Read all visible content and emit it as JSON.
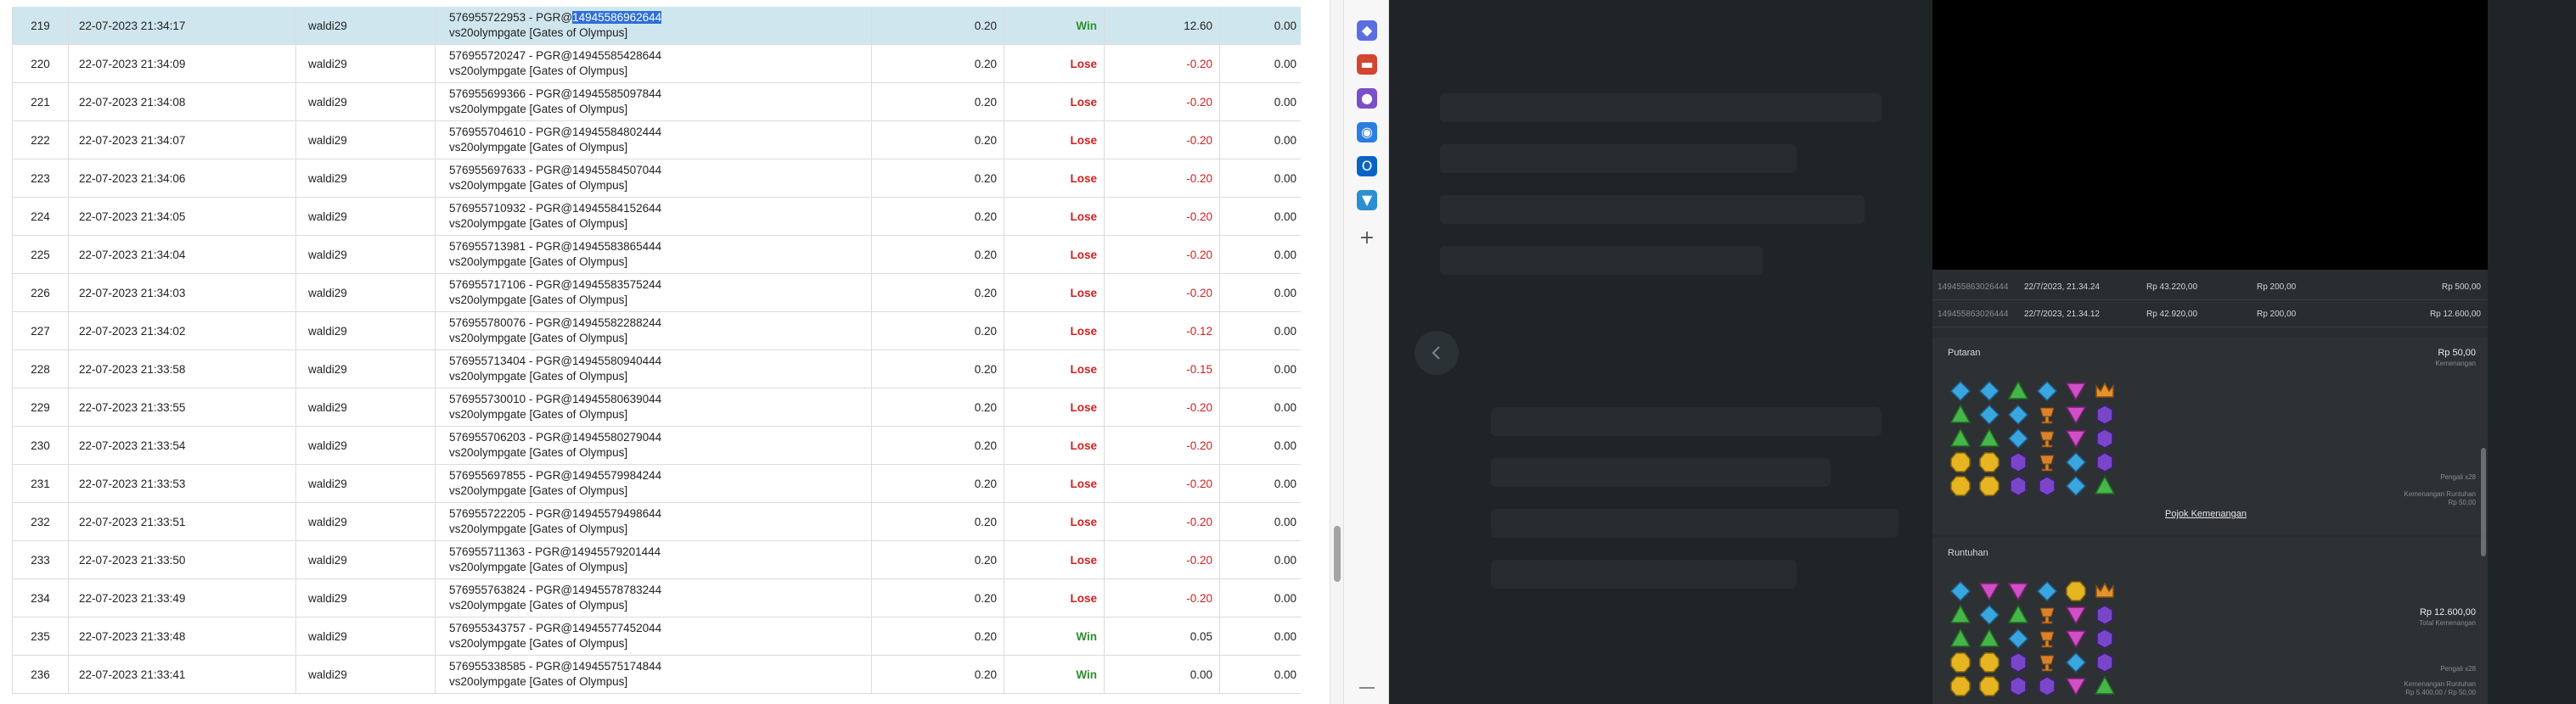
{
  "colors": {
    "selected_row": "#cfe6ee",
    "win": "#2f8f2f",
    "lose": "#d21f1f",
    "highlight": "#2f6fd6",
    "dark_bg": "#1f2427",
    "panel_bg": "#2a2d30"
  },
  "report": {
    "rows": [
      {
        "no": "219",
        "date": "22-07-2023 21:34:17",
        "user": "waldi29",
        "desc_prefix": "576955722953 - PGR@",
        "desc_hl": "14945586962644",
        "desc_line2": "vs20olympgate [Gates of Olympus]",
        "bet": "0.20",
        "result": "Win",
        "amount": "12.60",
        "balance": "0.00"
      },
      {
        "no": "220",
        "date": "22-07-2023 21:34:09",
        "user": "waldi29",
        "desc_prefix": "576955720247 - PGR@14945585428644",
        "desc_hl": "",
        "desc_line2": "vs20olympgate [Gates of Olympus]",
        "bet": "0.20",
        "result": "Lose",
        "amount": "-0.20",
        "balance": "0.00"
      },
      {
        "no": "221",
        "date": "22-07-2023 21:34:08",
        "user": "waldi29",
        "desc_prefix": "576955699366 - PGR@14945585097844",
        "desc_hl": "",
        "desc_line2": "vs20olympgate [Gates of Olympus]",
        "bet": "0.20",
        "result": "Lose",
        "amount": "-0.20",
        "balance": "0.00"
      },
      {
        "no": "222",
        "date": "22-07-2023 21:34:07",
        "user": "waldi29",
        "desc_prefix": "576955704610 - PGR@14945584802444",
        "desc_hl": "",
        "desc_line2": "vs20olympgate [Gates of Olympus]",
        "bet": "0.20",
        "result": "Lose",
        "amount": "-0.20",
        "balance": "0.00"
      },
      {
        "no": "223",
        "date": "22-07-2023 21:34:06",
        "user": "waldi29",
        "desc_prefix": "576955697633 - PGR@14945584507044",
        "desc_hl": "",
        "desc_line2": "vs20olympgate [Gates of Olympus]",
        "bet": "0.20",
        "result": "Lose",
        "amount": "-0.20",
        "balance": "0.00"
      },
      {
        "no": "224",
        "date": "22-07-2023 21:34:05",
        "user": "waldi29",
        "desc_prefix": "576955710932 - PGR@14945584152644",
        "desc_hl": "",
        "desc_line2": "vs20olympgate [Gates of Olympus]",
        "bet": "0.20",
        "result": "Lose",
        "amount": "-0.20",
        "balance": "0.00"
      },
      {
        "no": "225",
        "date": "22-07-2023 21:34:04",
        "user": "waldi29",
        "desc_prefix": "576955713981 - PGR@14945583865444",
        "desc_hl": "",
        "desc_line2": "vs20olympgate [Gates of Olympus]",
        "bet": "0.20",
        "result": "Lose",
        "amount": "-0.20",
        "balance": "0.00"
      },
      {
        "no": "226",
        "date": "22-07-2023 21:34:03",
        "user": "waldi29",
        "desc_prefix": "576955717106 - PGR@14945583575244",
        "desc_hl": "",
        "desc_line2": "vs20olympgate [Gates of Olympus]",
        "bet": "0.20",
        "result": "Lose",
        "amount": "-0.20",
        "balance": "0.00"
      },
      {
        "no": "227",
        "date": "22-07-2023 21:34:02",
        "user": "waldi29",
        "desc_prefix": "576955780076 - PGR@14945582288244",
        "desc_hl": "",
        "desc_line2": "vs20olympgate [Gates of Olympus]",
        "bet": "0.20",
        "result": "Lose",
        "amount": "-0.12",
        "balance": "0.00"
      },
      {
        "no": "228",
        "date": "22-07-2023 21:33:58",
        "user": "waldi29",
        "desc_prefix": "576955713404 - PGR@14945580940444",
        "desc_hl": "",
        "desc_line2": "vs20olympgate [Gates of Olympus]",
        "bet": "0.20",
        "result": "Lose",
        "amount": "-0.15",
        "balance": "0.00"
      },
      {
        "no": "229",
        "date": "22-07-2023 21:33:55",
        "user": "waldi29",
        "desc_prefix": "576955730010 - PGR@14945580639044",
        "desc_hl": "",
        "desc_line2": "vs20olympgate [Gates of Olympus]",
        "bet": "0.20",
        "result": "Lose",
        "amount": "-0.20",
        "balance": "0.00"
      },
      {
        "no": "230",
        "date": "22-07-2023 21:33:54",
        "user": "waldi29",
        "desc_prefix": "576955706203 - PGR@14945580279044",
        "desc_hl": "",
        "desc_line2": "vs20olympgate [Gates of Olympus]",
        "bet": "0.20",
        "result": "Lose",
        "amount": "-0.20",
        "balance": "0.00"
      },
      {
        "no": "231",
        "date": "22-07-2023 21:33:53",
        "user": "waldi29",
        "desc_prefix": "576955697855 - PGR@14945579984244",
        "desc_hl": "",
        "desc_line2": "vs20olympgate [Gates of Olympus]",
        "bet": "0.20",
        "result": "Lose",
        "amount": "-0.20",
        "balance": "0.00"
      },
      {
        "no": "232",
        "date": "22-07-2023 21:33:51",
        "user": "waldi29",
        "desc_prefix": "576955722205 - PGR@14945579498644",
        "desc_hl": "",
        "desc_line2": "vs20olympgate [Gates of Olympus]",
        "bet": "0.20",
        "result": "Lose",
        "amount": "-0.20",
        "balance": "0.00"
      },
      {
        "no": "233",
        "date": "22-07-2023 21:33:50",
        "user": "waldi29",
        "desc_prefix": "576955711363 - PGR@14945579201444",
        "desc_hl": "",
        "desc_line2": "vs20olympgate [Gates of Olympus]",
        "bet": "0.20",
        "result": "Lose",
        "amount": "-0.20",
        "balance": "0.00"
      },
      {
        "no": "234",
        "date": "22-07-2023 21:33:49",
        "user": "waldi29",
        "desc_prefix": "576955763824 - PGR@14945578783244",
        "desc_hl": "",
        "desc_line2": "vs20olympgate [Gates of Olympus]",
        "bet": "0.20",
        "result": "Lose",
        "amount": "-0.20",
        "balance": "0.00"
      },
      {
        "no": "235",
        "date": "22-07-2023 21:33:48",
        "user": "waldi29",
        "desc_prefix": "576955343757 - PGR@14945577452044",
        "desc_hl": "",
        "desc_line2": "vs20olympgate [Gates of Olympus]",
        "bet": "0.20",
        "result": "Win",
        "amount": "0.05",
        "balance": "0.00"
      },
      {
        "no": "236",
        "date": "22-07-2023 21:33:41",
        "user": "waldi29",
        "desc_prefix": "576955338585 - PGR@14945575174844",
        "desc_hl": "",
        "desc_line2": "vs20olympgate [Gates of Olympus]",
        "bet": "0.20",
        "result": "Win",
        "amount": "0.00",
        "balance": "0.00"
      }
    ]
  },
  "sidebar": {
    "icons": [
      {
        "name": "tag-icon",
        "color": "#5b6ee1",
        "glyph": "◆"
      },
      {
        "name": "toolbox-icon",
        "color": "#d2452f",
        "glyph": "▬"
      },
      {
        "name": "people-icon",
        "color": "#7b4fc9",
        "glyph": "●"
      },
      {
        "name": "copilot-icon",
        "color": "#2b7de0",
        "glyph": "◉"
      },
      {
        "name": "outlook-icon",
        "color": "#0a64c8",
        "glyph": "O"
      },
      {
        "name": "shopping-icon",
        "color": "#2c8fd0",
        "glyph": "▼"
      }
    ],
    "plus": "+"
  },
  "history": {
    "rows": [
      {
        "id": "149455863026444",
        "date": "22/7/2023, 21.34.24",
        "balance": "Rp 43.220,00",
        "bet": "Rp 200,00",
        "win": "Rp 500,00"
      },
      {
        "id": "149455863026444",
        "date": "22/7/2023, 21.34.12",
        "balance": "Rp 42.920,00",
        "bet": "Rp 200,00",
        "win": "Rp 12.600,00"
      }
    ],
    "sections": [
      {
        "title": "Putaran",
        "amount": "Rp 50,00",
        "amount_sub": "Kemenangan",
        "link": "Pojok Kemenangan",
        "notes": [
          "Pengali x28",
          "Kemenangan Runtuhan",
          "Rp 50,00"
        ],
        "grid": [
          [
            "blue",
            "blue",
            "green",
            "blue",
            "pink",
            "crown"
          ],
          [
            "green",
            "blue",
            "blue",
            "cup",
            "pink",
            "purple"
          ],
          [
            "green",
            "green",
            "blue",
            "cup",
            "pink",
            "purple"
          ],
          [
            "yellow",
            "yellow",
            "purple",
            "cup",
            "blue",
            "purple"
          ],
          [
            "yellow",
            "yellow",
            "purple",
            "purple",
            "blue",
            "green"
          ]
        ]
      },
      {
        "title": "Runtuhan",
        "amount": "Rp 12.600,00",
        "amount_sub": "Total Kemenangan",
        "link": "",
        "notes": [
          "Pengali x28",
          "Kemenangan Runtuhan",
          "Rp 5.400,00 / Rp 50,00"
        ],
        "grid": [
          [
            "blue",
            "pink",
            "pink",
            "blue",
            "yellow",
            "crown"
          ],
          [
            "green",
            "blue",
            "green",
            "cup",
            "pink",
            "purple"
          ],
          [
            "green",
            "green",
            "blue",
            "cup",
            "pink",
            "purple"
          ],
          [
            "yellow",
            "yellow",
            "purple",
            "cup",
            "blue",
            "purple"
          ],
          [
            "yellow",
            "yellow",
            "purple",
            "purple",
            "pink",
            "green"
          ]
        ]
      }
    ]
  }
}
